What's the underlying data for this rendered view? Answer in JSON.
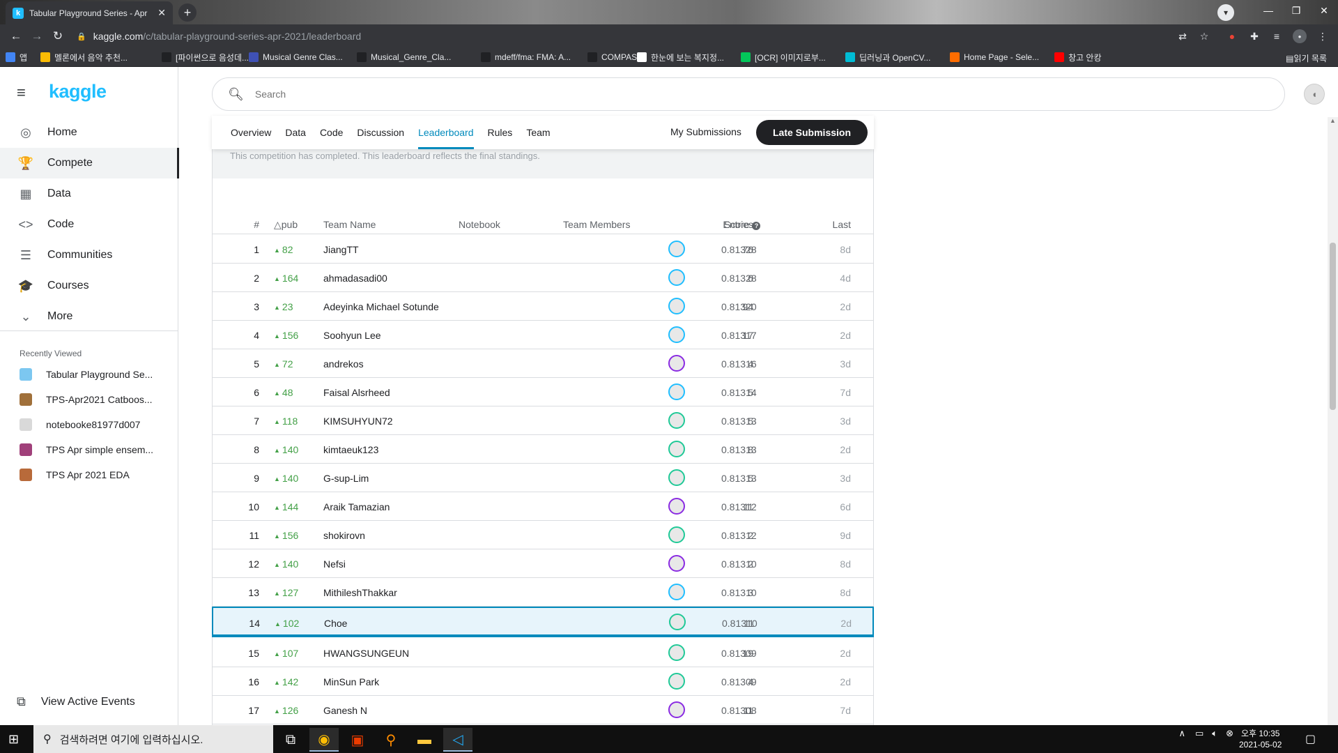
{
  "browser": {
    "tab_title": "Tabular Playground Series - Apr",
    "tab_icon": "kaggle-favicon",
    "url_host": "kaggle.com",
    "url_path": "/c/tabular-playground-series-apr-2021/leaderboard",
    "bookmarks": [
      {
        "label": "앱",
        "icon": "apps-grid-icon",
        "color": "#4285f4"
      },
      {
        "label": "멜론에서 음악 추천...",
        "icon": "k-icon",
        "color": "#fbbc04"
      },
      {
        "label": "[파이썬으로 음성데...",
        "icon": "page-icon",
        "color": "#202124"
      },
      {
        "label": "Musical Genre Clas...",
        "icon": "page-icon",
        "color": "#3f51b5"
      },
      {
        "label": "Musical_Genre_Cla...",
        "icon": "page-icon",
        "color": "#202124"
      },
      {
        "label": "mdeff/fma: FMA: A...",
        "icon": "github-icon",
        "color": "#202124"
      },
      {
        "label": "COMPAS",
        "icon": "page-icon",
        "color": "#202124"
      },
      {
        "label": "한눈에 보는 복지정...",
        "icon": "globe-icon",
        "color": "#ffffff"
      },
      {
        "label": "[OCR] 이미지로부...",
        "icon": "page-icon",
        "color": "#03c75a"
      },
      {
        "label": "딥러닝과 OpenCV...",
        "icon": "d2-icon",
        "color": "#00bcd4"
      },
      {
        "label": "Home Page - Sele...",
        "icon": "page-icon",
        "color": "#ff6d00"
      },
      {
        "label": "창고 안캉",
        "icon": "youtube-icon",
        "color": "#ff0000"
      }
    ],
    "reading_list": "읽기 목록"
  },
  "sidebar": {
    "logo": "kaggle",
    "nav": [
      {
        "label": "Home",
        "icon": "home-compass-icon",
        "glyph": "◎"
      },
      {
        "label": "Compete",
        "icon": "trophy-icon",
        "glyph": "🏆"
      },
      {
        "label": "Data",
        "icon": "table-icon",
        "glyph": "▦"
      },
      {
        "label": "Code",
        "icon": "code-icon",
        "glyph": "<>"
      },
      {
        "label": "Communities",
        "icon": "comments-icon",
        "glyph": "☰"
      },
      {
        "label": "Courses",
        "icon": "graduation-cap-icon",
        "glyph": "🎓"
      },
      {
        "label": "More",
        "icon": "chevron-down-icon",
        "glyph": "⌄"
      }
    ],
    "active_nav": "Compete",
    "recently_viewed_title": "Recently Viewed",
    "recently_viewed": [
      {
        "label": "Tabular Playground Se...",
        "color": "#7cc7f0"
      },
      {
        "label": "TPS-Apr2021 Catboos...",
        "color": "#a0703a"
      },
      {
        "label": "notebooke81977d007",
        "color": "#d9d9d9"
      },
      {
        "label": "TPS Apr simple ensem...",
        "color": "#a0407a"
      },
      {
        "label": "TPS Apr 2021 EDA",
        "color": "#b86a3a"
      }
    ],
    "view_active_events": "View Active Events"
  },
  "search": {
    "placeholder": "Search"
  },
  "competition": {
    "tabs": [
      "Overview",
      "Data",
      "Code",
      "Discussion",
      "Leaderboard",
      "Rules",
      "Team"
    ],
    "active_tab": "Leaderboard",
    "my_submissions": "My Submissions",
    "late_submission": "Late Submission",
    "completed_note": "This competition has completed. This leaderboard reflects the final standings."
  },
  "leaderboard": {
    "columns": {
      "rank": "#",
      "delta": "△pub",
      "team": "Team Name",
      "notebook": "Notebook",
      "members": "Team Members",
      "score": "Score",
      "entries": "Entries",
      "last": "Last"
    },
    "score_help_icon": "help-circle-icon",
    "highlight_rank": 14,
    "rows": [
      {
        "rank": "1",
        "delta": "82",
        "team": "JiangTT",
        "score": "0.81328",
        "entries": "76",
        "last": "8d",
        "ring": "#20beff"
      },
      {
        "rank": "2",
        "delta": "164",
        "team": "ahmadasadi00",
        "score": "0.81328",
        "entries": "6",
        "last": "4d",
        "ring": "#20beff"
      },
      {
        "rank": "3",
        "delta": "23",
        "team": "Adeyinka Michael Sotunde",
        "score": "0.81320",
        "entries": "94",
        "last": "2d",
        "ring": "#20beff"
      },
      {
        "rank": "4",
        "delta": "156",
        "team": "Soohyun Lee",
        "score": "0.81317",
        "entries": "17",
        "last": "2d",
        "ring": "#20beff"
      },
      {
        "rank": "5",
        "delta": "72",
        "team": "andrekos",
        "score": "0.81316",
        "entries": "4",
        "last": "3d",
        "ring": "#8a2be2"
      },
      {
        "rank": "6",
        "delta": "48",
        "team": "Faisal Alsrheed",
        "score": "0.81314",
        "entries": "5",
        "last": "7d",
        "ring": "#20beff"
      },
      {
        "rank": "7",
        "delta": "118",
        "team": "KIMSUHYUN72",
        "score": "0.81313",
        "entries": "5",
        "last": "3d",
        "ring": "#20c997"
      },
      {
        "rank": "8",
        "delta": "140",
        "team": "kimtaeuk123",
        "score": "0.81313",
        "entries": "8",
        "last": "2d",
        "ring": "#20c997"
      },
      {
        "rank": "9",
        "delta": "140",
        "team": "G-sup-Lim",
        "score": "0.81313",
        "entries": "5",
        "last": "3d",
        "ring": "#20c997"
      },
      {
        "rank": "10",
        "delta": "144",
        "team": "Araik Tamazian",
        "score": "0.81312",
        "entries": "11",
        "last": "6d",
        "ring": "#8a2be2"
      },
      {
        "rank": "11",
        "delta": "156",
        "team": "shokirovn",
        "score": "0.81312",
        "entries": "2",
        "last": "9d",
        "ring": "#20c997"
      },
      {
        "rank": "12",
        "delta": "140",
        "team": "Nefsi",
        "score": "0.81310",
        "entries": "2",
        "last": "8d",
        "ring": "#8a2be2"
      },
      {
        "rank": "13",
        "delta": "127",
        "team": "MithileshThakkar",
        "score": "0.81310",
        "entries": "3",
        "last": "8d",
        "ring": "#20beff"
      },
      {
        "rank": "14",
        "delta": "102",
        "team": "Choe",
        "score": "0.81310",
        "entries": "11",
        "last": "2d",
        "ring": "#20c997"
      },
      {
        "rank": "15",
        "delta": "107",
        "team": "HWANGSUNGEUN",
        "score": "0.81309",
        "entries": "19",
        "last": "2d",
        "ring": "#20c997"
      },
      {
        "rank": "16",
        "delta": "142",
        "team": "MinSun Park",
        "score": "0.81309",
        "entries": "4",
        "last": "2d",
        "ring": "#20c997"
      },
      {
        "rank": "17",
        "delta": "126",
        "team": "Ganesh N",
        "score": "0.81308",
        "entries": "11",
        "last": "7d",
        "ring": "#8a2be2"
      }
    ]
  },
  "taskbar": {
    "search_placeholder": "검색하려면 여기에 입력하십시오.",
    "time": "오후 10:35",
    "date": "2021-05-02"
  },
  "colors": {
    "accent": "#20beff",
    "active_tab": "#008abc",
    "delta_up": "#43a047"
  }
}
